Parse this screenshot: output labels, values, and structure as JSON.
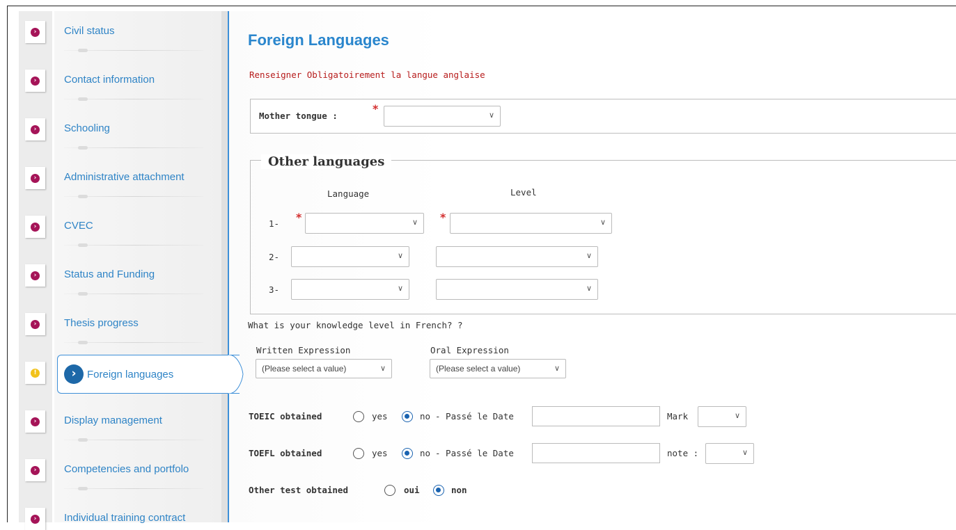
{
  "sidebar": {
    "items": [
      {
        "label": "Civil status",
        "status": "pending"
      },
      {
        "label": "Contact information",
        "status": "pending"
      },
      {
        "label": "Schooling",
        "status": "pending"
      },
      {
        "label": "Administrative attachment",
        "status": "pending"
      },
      {
        "label": "CVEC",
        "status": "pending"
      },
      {
        "label": "Status and Funding",
        "status": "pending"
      },
      {
        "label": "Thesis progress",
        "status": "pending"
      },
      {
        "label": "Foreign languages",
        "status": "active"
      },
      {
        "label": "Display management",
        "status": "pending"
      },
      {
        "label": "Competencies and portfolo",
        "status": "pending"
      },
      {
        "label": "Individual training contract",
        "status": "pending"
      }
    ],
    "icon_pending": "chevron-right-icon",
    "icon_active": "warning-icon"
  },
  "main": {
    "title": "Foreign Languages",
    "warning": "Renseigner Obligatoirement la langue anglaise",
    "mother_tongue": {
      "label": "Mother tongue :",
      "required_mark": "*",
      "value": ""
    },
    "other_languages": {
      "legend": "Other languages",
      "col_language": "Language",
      "col_level": "Level",
      "rows": [
        {
          "num": "1-",
          "language": "",
          "level": "",
          "required_mark": "*"
        },
        {
          "num": "2-",
          "language": "",
          "level": ""
        },
        {
          "num": "3-",
          "language": "",
          "level": ""
        }
      ]
    },
    "french": {
      "question": "What is your knowledge level in French? ?",
      "written_label": "Written Expression",
      "written_value": "(Please select a value)",
      "oral_label": "Oral Expression",
      "oral_value": "(Please select a value)"
    },
    "toeic": {
      "label": "TOEIC obtained",
      "yes": "yes",
      "no": "no",
      "date_label": "- Passé le Date",
      "date_value": "",
      "mark_label": "Mark",
      "selected": "no"
    },
    "toefl": {
      "label": "TOEFL obtained",
      "yes": "yes",
      "no": "no",
      "date_label": "- Passé le Date",
      "date_value": "",
      "mark_label": "note :",
      "selected": "no"
    },
    "other_test": {
      "label": "Other test obtained",
      "yes": "oui",
      "no": "non",
      "selected": "non"
    }
  },
  "colors": {
    "accent": "#2a86cd",
    "warning_text": "#b71c1c",
    "pending_dot": "#a51458",
    "active_dot": "#f2c21b",
    "radio_selected": "#1a63b0"
  }
}
